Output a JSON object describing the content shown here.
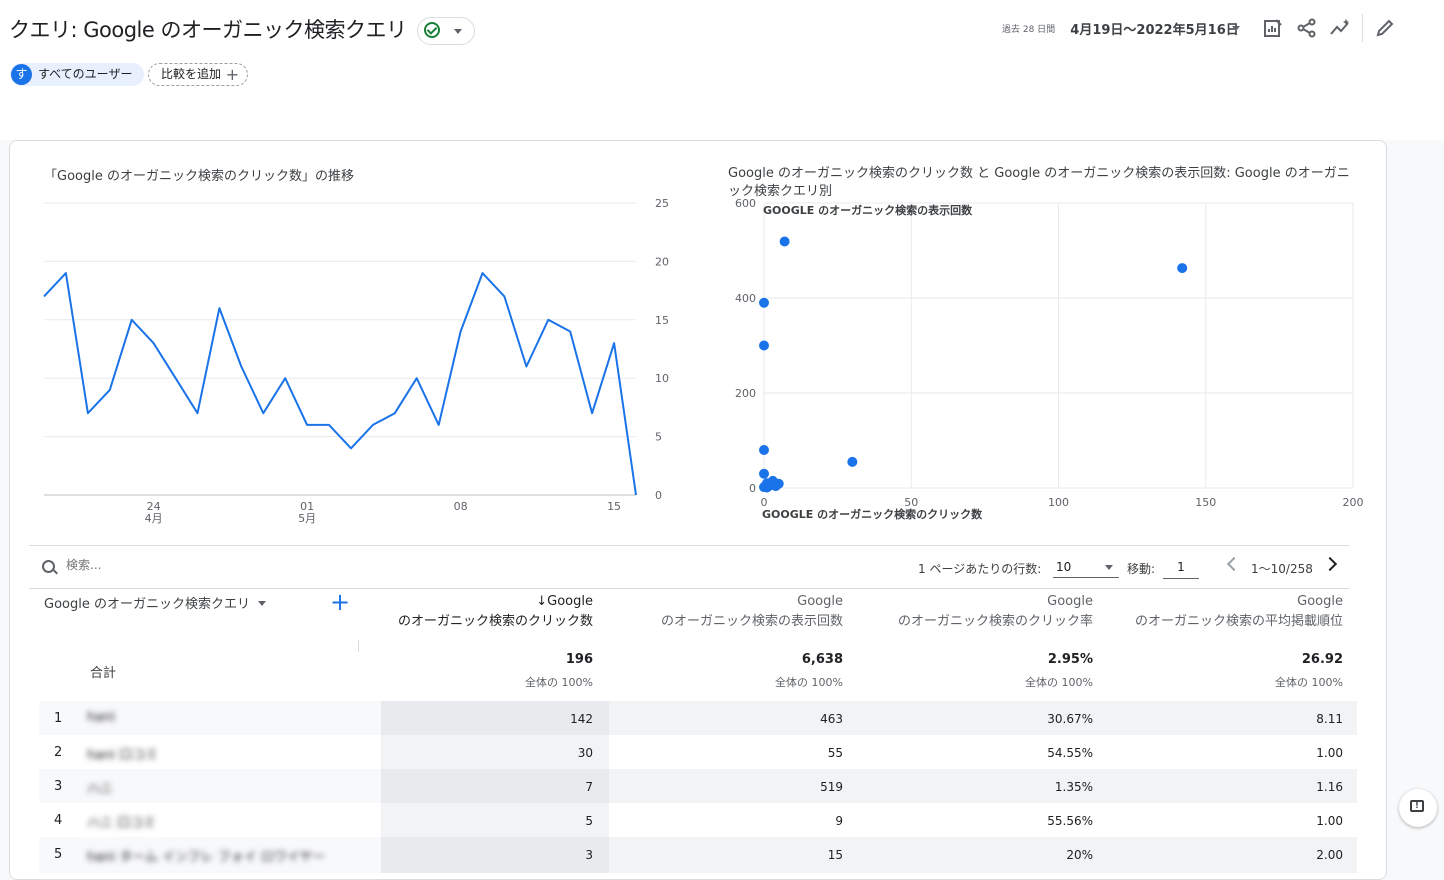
{
  "header": {
    "title": "クエリ: Google のオーガニック検索クエリ",
    "date_prefix": "過去 28 日間",
    "date_range": "4月19日～2022年5月16日"
  },
  "segments": {
    "user_avatar": "す",
    "user_label": "すべてのユーザー",
    "compare_label": "比較を追加"
  },
  "icons": [
    "customize-report-icon",
    "share-icon",
    "insights-icon",
    "edit-icon"
  ],
  "colors": {
    "accent": "#1a73e8",
    "line": "#1a73e8",
    "check": "#188038"
  },
  "line_chart_title": "「Google のオーガニック検索のクリック数」の推移",
  "scatter_title_1": "Google のオーガニック検索のクリック数 と Google のオーガニック検索の表示回数: Google のオーガニ",
  "scatter_title_2": "ック検索クエリ別",
  "chart_data": [
    {
      "type": "line",
      "title": "「Google のオーガニック検索のクリック数」の推移",
      "x_tick_labels": [
        [
          "24",
          "4月"
        ],
        [
          "01",
          "5月"
        ],
        [
          "08",
          ""
        ],
        [
          "15",
          ""
        ]
      ],
      "x_tick_indices": [
        5,
        12,
        19,
        26
      ],
      "y_ticks": [
        0,
        5,
        10,
        15,
        20,
        25
      ],
      "ylim": [
        0,
        25
      ],
      "values": [
        17,
        19,
        7,
        9,
        15,
        13,
        10,
        7,
        16,
        11,
        7,
        10,
        6,
        6,
        4,
        6,
        7,
        10,
        6,
        14,
        19,
        17,
        11,
        15,
        14,
        7,
        13,
        0
      ]
    },
    {
      "type": "scatter",
      "xlabel": "GOOGLE のオーガニック検索のクリック数",
      "ylabel": "GOOGLE のオーガニック検索の表示回数",
      "xlim": [
        0,
        200
      ],
      "ylim": [
        0,
        600
      ],
      "x_ticks": [
        0,
        50,
        100,
        150,
        200
      ],
      "y_ticks": [
        0,
        200,
        400,
        600
      ],
      "points": [
        {
          "x": 142,
          "y": 463
        },
        {
          "x": 30,
          "y": 55
        },
        {
          "x": 7,
          "y": 519
        },
        {
          "x": 5,
          "y": 9
        },
        {
          "x": 3,
          "y": 15
        },
        {
          "x": 0,
          "y": 390
        },
        {
          "x": 0,
          "y": 300
        },
        {
          "x": 0,
          "y": 80
        },
        {
          "x": 0,
          "y": 30
        },
        {
          "x": 1,
          "y": 10
        },
        {
          "x": 2,
          "y": 5
        },
        {
          "x": 4,
          "y": 4
        },
        {
          "x": 0,
          "y": 2
        },
        {
          "x": 1,
          "y": 1
        }
      ]
    }
  ],
  "controls": {
    "search_placeholder": "検索...",
    "rows_label": "1 ページあたりの行数:",
    "rows_value": "10",
    "goto_label": "移動:",
    "goto_value": "1",
    "page_info": "1～10/258"
  },
  "table": {
    "dimension_header": "Google のオーガニック検索クエリ",
    "columns": [
      {
        "line1": "↓Google",
        "line2": "のオーガニック検索のクリック数"
      },
      {
        "line1": "Google",
        "line2": "のオーガニック検索の表示回数"
      },
      {
        "line1": "Google",
        "line2": "のオーガニック検索のクリック率"
      },
      {
        "line1": "Google",
        "line2": "のオーガニック検索の平均掲載順位"
      }
    ],
    "total_label": "合計",
    "totals": [
      {
        "value": "196",
        "sub": "全体の 100%"
      },
      {
        "value": "6,638",
        "sub": "全体の 100%"
      },
      {
        "value": "2.95%",
        "sub": "全体の 100%"
      },
      {
        "value": "26.92",
        "sub": "全体の 100%"
      }
    ],
    "rows": [
      {
        "idx": "1",
        "query": "hani",
        "values": [
          "142",
          "463",
          "30.67%",
          "8.11"
        ]
      },
      {
        "idx": "2",
        "query": "hani 口コミ",
        "values": [
          "30",
          "55",
          "54.55%",
          "1.00"
        ]
      },
      {
        "idx": "3",
        "query": "ハニ",
        "values": [
          "7",
          "519",
          "1.35%",
          "1.16"
        ]
      },
      {
        "idx": "4",
        "query": "ハニ 口コミ",
        "values": [
          "5",
          "9",
          "55.56%",
          "1.00"
        ]
      },
      {
        "idx": "5",
        "query": "hani ターム インフレ フォイ ロワイヤー",
        "values": [
          "3",
          "15",
          "20%",
          "2.00"
        ]
      }
    ]
  }
}
